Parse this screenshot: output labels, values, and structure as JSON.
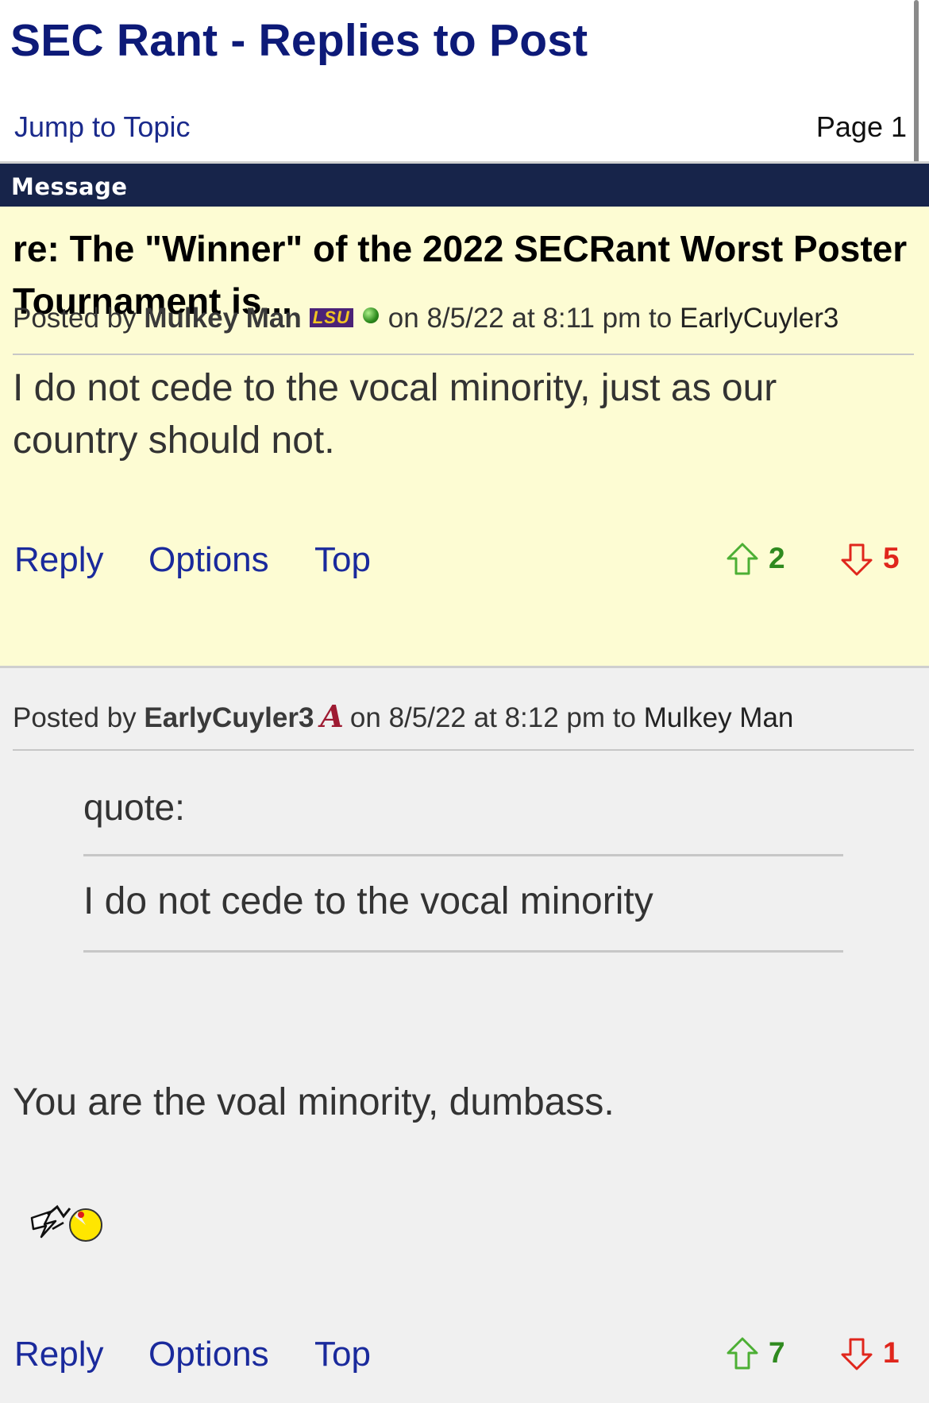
{
  "header": {
    "title": "SEC Rant - Replies to Post",
    "jump_link": "Jump to Topic",
    "page_label": "Page 1"
  },
  "message_bar": {
    "label": "Message"
  },
  "colors": {
    "title": "#0d1a78",
    "link": "#1a2a9c",
    "message_bar": "#17244a",
    "highlighted_post_bg": "#fdfcd3",
    "reply_post_bg": "#f0f0f0",
    "upvote": "#2f8a1f",
    "downvote": "#e0261c"
  },
  "posts": [
    {
      "subject": "re: The \"Winner\" of the 2022 SECRant Worst Poster Tournament is...",
      "posted_by_label": "Posted by",
      "author": "Mulkey Man",
      "author_badge": "LSU",
      "online_status_icon": "online-dot-icon",
      "on_label": "on",
      "date": "8/5/22",
      "at_label": "at",
      "time": "8:11 pm",
      "to_label": "to",
      "reply_to": "EarlyCuyler3",
      "body": "I do not cede to the vocal minority, just as our country should not.",
      "actions": {
        "reply": "Reply",
        "options": "Options",
        "top": "Top"
      },
      "upvotes": "2",
      "downvotes": "5"
    },
    {
      "posted_by_label": "Posted by",
      "author": "EarlyCuyler3",
      "author_badge_icon": "alabama-a-icon",
      "on_label": "on",
      "date": "8/5/22",
      "at_label": "at",
      "time": "8:12 pm",
      "to_label": "to",
      "reply_to": "Mulkey Man",
      "quote_label": "quote:",
      "quote_text": "I do not cede to the vocal minority",
      "body": "You are the voal minority, dumbass.",
      "emoticon_icon": "pacman-chase-emoticon-icon",
      "actions": {
        "reply": "Reply",
        "options": "Options",
        "top": "Top"
      },
      "upvotes": "7",
      "downvotes": "1"
    }
  ]
}
